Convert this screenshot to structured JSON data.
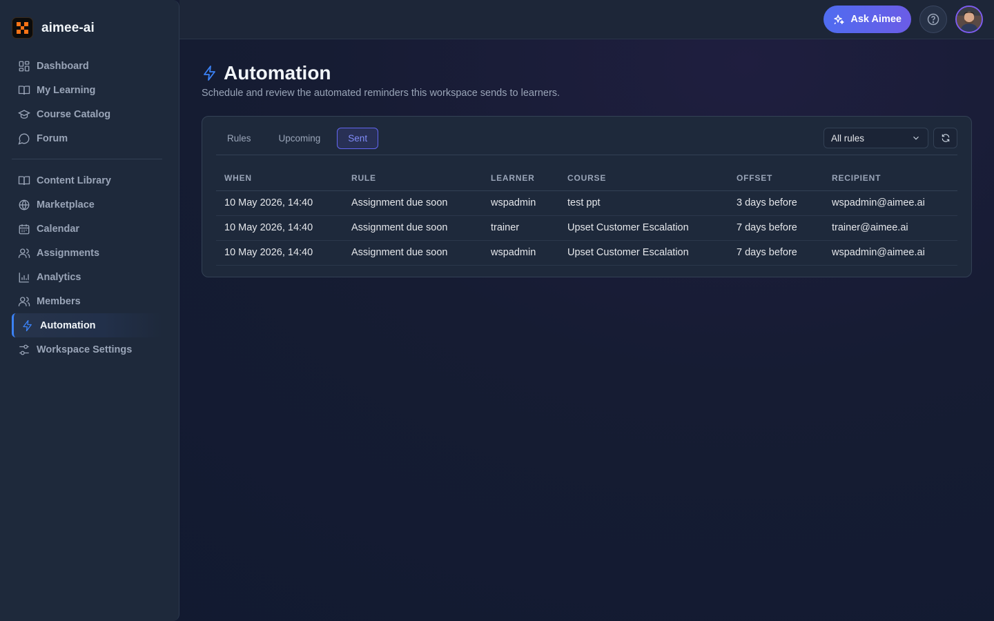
{
  "brand": {
    "name": "aimee-ai"
  },
  "sidebar": {
    "primary": [
      {
        "label": "Dashboard",
        "icon": "dashboard-icon"
      },
      {
        "label": "My Learning",
        "icon": "book-open-icon"
      },
      {
        "label": "Course Catalog",
        "icon": "graduation-cap-icon"
      },
      {
        "label": "Forum",
        "icon": "chat-bubble-icon"
      }
    ],
    "secondary": [
      {
        "label": "Content Library",
        "icon": "book-open-icon"
      },
      {
        "label": "Marketplace",
        "icon": "globe-icon"
      },
      {
        "label": "Calendar",
        "icon": "calendar-icon"
      },
      {
        "label": "Assignments",
        "icon": "users-icon"
      },
      {
        "label": "Analytics",
        "icon": "bar-chart-icon"
      },
      {
        "label": "Members",
        "icon": "users-icon"
      },
      {
        "label": "Automation",
        "icon": "lightning-icon",
        "active": true
      },
      {
        "label": "Workspace Settings",
        "icon": "sliders-icon"
      }
    ]
  },
  "topbar": {
    "ask_label": "Ask Aimee",
    "ask_icon": "sparkles-icon",
    "help_icon": "help-circle-icon"
  },
  "page": {
    "title": "Automation",
    "subtitle": "Schedule and review the automated reminders this workspace sends to learners."
  },
  "tabs": [
    {
      "label": "Rules",
      "active": false
    },
    {
      "label": "Upcoming",
      "active": false
    },
    {
      "label": "Sent",
      "active": true
    }
  ],
  "filter": {
    "selected": "All rules"
  },
  "table": {
    "columns": [
      "WHEN",
      "RULE",
      "LEARNER",
      "COURSE",
      "OFFSET",
      "RECIPIENT"
    ],
    "rows": [
      [
        "10 May 2026, 14:40",
        "Assignment due soon",
        "wspadmin",
        "test ppt",
        "3 days before",
        "wspadmin@aimee.ai"
      ],
      [
        "10 May 2026, 14:40",
        "Assignment due soon",
        "trainer",
        "Upset Customer Escalation",
        "7 days before",
        "trainer@aimee.ai"
      ],
      [
        "10 May 2026, 14:40",
        "Assignment due soon",
        "wspadmin",
        "Upset Customer Escalation",
        "7 days before",
        "wspadmin@aimee.ai"
      ]
    ]
  },
  "colors": {
    "accent": "#3b82f6",
    "tab_active": "#6366f1",
    "sidebar_bg": "#1e293b"
  }
}
